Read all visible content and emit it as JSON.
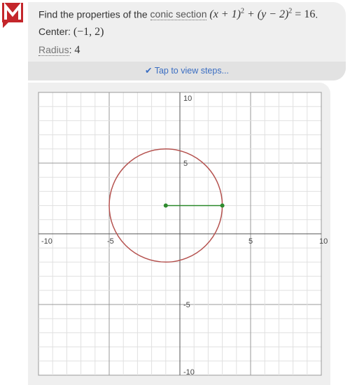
{
  "problem": {
    "prefix": "Find the properties of the",
    "link": "conic section",
    "equation_a": "(x + 1)",
    "equation_b": " + (y − 2)",
    "equation_c": " = 16",
    "suffix": "."
  },
  "center": {
    "label": "Center:",
    "value": "(−1, 2)"
  },
  "radius": {
    "label": "Radius",
    "colon": ":",
    "value": "4"
  },
  "steps_button": {
    "label": "Tap to view steps...",
    "icon": "check-circle-icon"
  },
  "logo": {
    "text": "M",
    "color": "#c4262b"
  },
  "colors": {
    "circle": "#b5524f",
    "radius_line": "#2e8b2e",
    "accent": "#3b6ec2"
  },
  "chart_data": {
    "type": "line",
    "xlim": [
      -10,
      10
    ],
    "ylim": [
      -10,
      10
    ],
    "x_ticks": [
      "-10",
      "-5",
      "5",
      "10"
    ],
    "y_ticks": [
      "10",
      "5",
      "-5",
      "-10"
    ],
    "grid": true,
    "circle": {
      "center": [
        -1,
        2
      ],
      "radius": 4
    },
    "segment": {
      "from": [
        -1,
        2
      ],
      "to": [
        3,
        2
      ]
    }
  }
}
